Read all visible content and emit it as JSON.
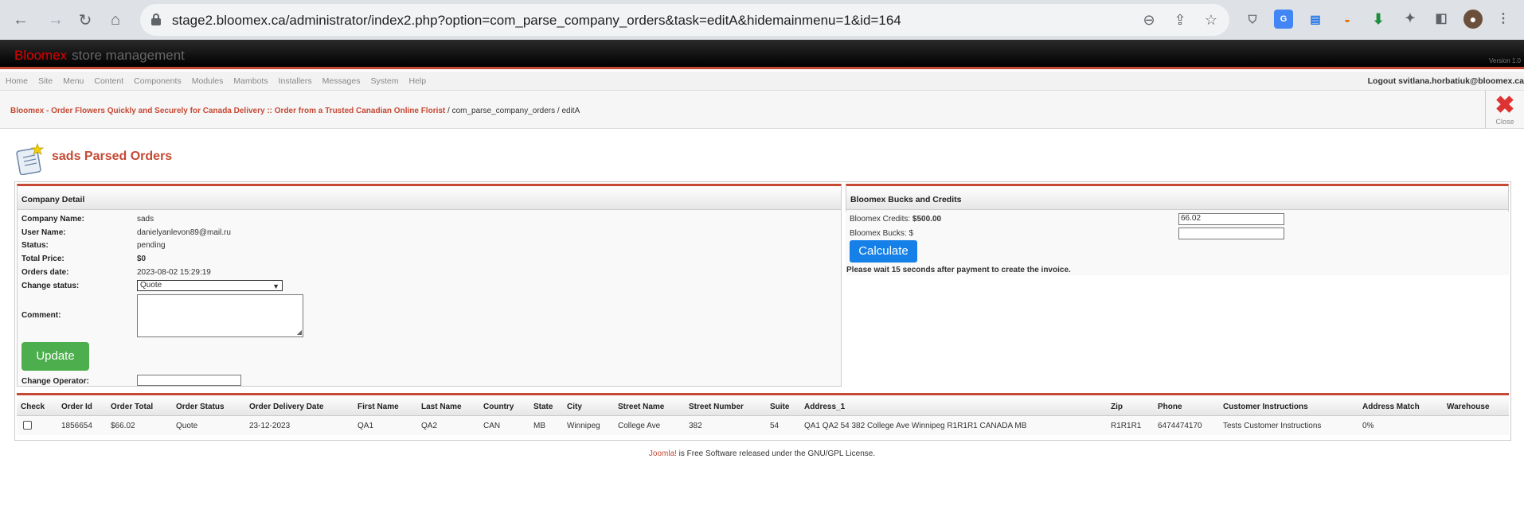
{
  "browser": {
    "url": "stage2.bloomex.ca/administrator/index2.php?option=com_parse_company_orders&task=editA&hidemainmenu=1&id=164"
  },
  "header": {
    "brand": "Bloomex",
    "subtitle": "store management",
    "version": "Version 1.0"
  },
  "menu": {
    "items": [
      "Home",
      "Site",
      "Menu",
      "Content",
      "Components",
      "Modules",
      "Mambots",
      "Installers",
      "Messages",
      "System",
      "Help"
    ],
    "logout": "Logout svitlana.horbatiuk@bloomex.ca"
  },
  "pathway": {
    "link": "Bloomex - Order Flowers Quickly and Securely for Canada Delivery :: Order from a Trusted Canadian Online Florist",
    "rest": " / com_parse_company_orders / editA"
  },
  "toolbar": {
    "close_label": "Close"
  },
  "page": {
    "title": "sads Parsed Orders"
  },
  "company": {
    "heading": "Company Detail",
    "company_name_label": "Company Name:",
    "company_name": "sads",
    "user_name_label": "User Name:",
    "user_name": "danielyanlevon89@mail.ru",
    "status_label": "Status:",
    "status": "pending",
    "total_price_label": "Total Price:",
    "total_price": "$0",
    "orders_date_label": "Orders date:",
    "orders_date": "2023-08-02 15:29:19",
    "change_status_label": "Change status:",
    "change_status_value": "Quote",
    "comment_label": "Comment:",
    "update_label": "Update",
    "change_operator_label": "Change Operator:"
  },
  "credits": {
    "heading": "Bloomex Bucks and Credits",
    "credits_label": "Bloomex Credits:",
    "credits_value": "$500.00",
    "credits_input": "66.02",
    "bucks_label": "Bloomex Bucks: $",
    "calculate_label": "Calculate",
    "note": "Please wait 15 seconds after payment to create the invoice."
  },
  "orders_table": {
    "headers": [
      "Check",
      "Order Id",
      "Order Total",
      "Order Status",
      "Order Delivery Date",
      "First Name",
      "Last Name",
      "Country",
      "State",
      "City",
      "Street Name",
      "Street Number",
      "Suite",
      "Address_1",
      "Zip",
      "Phone",
      "Customer Instructions",
      "Address Match",
      "Warehouse"
    ],
    "rows": [
      {
        "order_id": "1856654",
        "order_total": "$66.02",
        "order_status": "Quote",
        "delivery_date": "23-12-2023",
        "first_name": "QA1",
        "last_name": "QA2",
        "country": "CAN",
        "state": "MB",
        "city": "Winnipeg",
        "street_name": "College Ave",
        "street_number": "382",
        "suite": "54",
        "address_1": "QA1 QA2 54 382 College Ave Winnipeg R1R1R1 CANADA MB",
        "zip": "R1R1R1",
        "phone": "6474474170",
        "instructions": "Tests Customer Instructions",
        "address_match": "0%",
        "warehouse": ""
      }
    ]
  },
  "footer": {
    "joomla": "Joomla!",
    "text": " is Free Software released under the GNU/GPL License."
  }
}
